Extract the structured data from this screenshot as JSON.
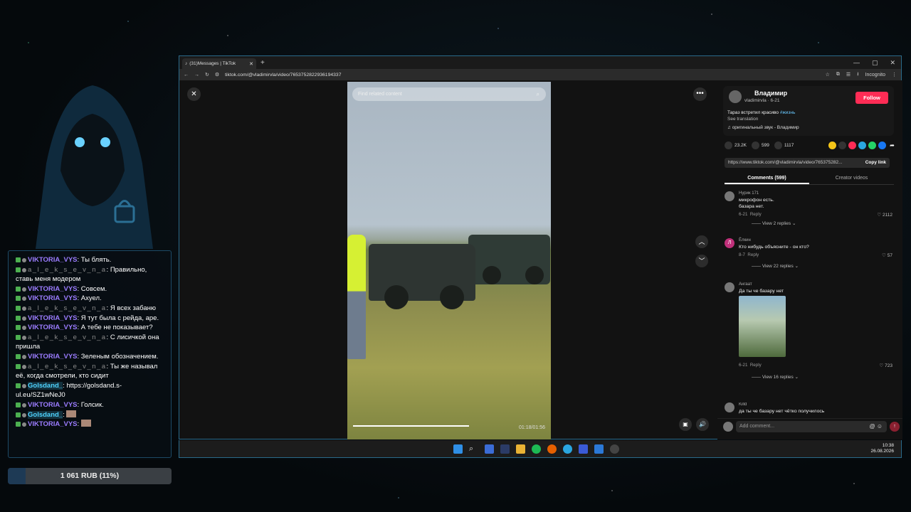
{
  "chat": {
    "messages": [
      {
        "user": "VIKTORIA_VYS",
        "kind": "v",
        "text": "Ты блять."
      },
      {
        "user": "a_l_e_k_s_e_v_n_a",
        "kind": "a",
        "text": "Правильно, ставь меня модером"
      },
      {
        "user": "VIKTORIA_VYS",
        "kind": "v",
        "text": "Совсем."
      },
      {
        "user": "VIKTORIA_VYS",
        "kind": "v",
        "text": "Ахуел."
      },
      {
        "user": "a_l_e_k_s_e_v_n_a",
        "kind": "a",
        "text": "Я всех забаню"
      },
      {
        "user": "VIKTORIA_VYS",
        "kind": "v",
        "text": "Я тут была с рейда, аре."
      },
      {
        "user": "VIKTORIA_VYS",
        "kind": "v",
        "text": "А тебе не показывает?"
      },
      {
        "user": "a_l_e_k_s_e_v_n_a",
        "kind": "a",
        "text": "С лисичкой она пришла"
      },
      {
        "user": "VIKTORIA_VYS",
        "kind": "v",
        "text": "Зеленым обозначением."
      },
      {
        "user": "a_l_e_k_s_e_v_n_a",
        "kind": "a",
        "text": "Ты же называл её, когда смотрели, кто сидит"
      },
      {
        "user": "Golsdand_",
        "kind": "g",
        "text": "https://golsdand.s-ul.eu/SZ1wNeJ0"
      },
      {
        "user": "VIKTORIA_VYS",
        "kind": "v",
        "text": "Голсик."
      },
      {
        "user": "Golsdand_",
        "kind": "g",
        "text": ""
      },
      {
        "user": "VIKTORIA_VYS",
        "kind": "v",
        "text": ""
      }
    ]
  },
  "donation": {
    "label": "1 061 RUB (11%)",
    "progress": 0.11
  },
  "browser": {
    "tab_title": "(31)Messages | TikTok",
    "url": "tiktok.com/@vladimirvla/video/7653752822936194337",
    "incognito": "Incognito"
  },
  "video": {
    "search_placeholder": "Find related content",
    "time": "01:18/01:56",
    "progress": 0.6
  },
  "author": {
    "name": "Владимир",
    "handle": "vladimirvla · 6-21",
    "follow": "Follow",
    "desc": "Тараз встретил красиво",
    "hashtag": "#жизнь",
    "translation": "See translation",
    "music": "оригинальный звук - Владимир"
  },
  "stats": {
    "likes": "23.2K",
    "comments": "599",
    "saves": "1117"
  },
  "link": {
    "url": "https://www.tiktok.com/@vladimirvla/video/765375282...",
    "copy": "Copy link"
  },
  "tabs": {
    "comments": "Comments (599)",
    "creator": "Creator videos"
  },
  "comments": [
    {
      "name": "Нурик 171",
      "text": "микрофон есть.\nбазара нет.",
      "date": "6-21",
      "reply": "Reply",
      "likes": "2112",
      "replies": "View 2 replies"
    },
    {
      "name": "Ёлкин",
      "text": "Кто нибудь объясните - он кто?",
      "date": "8-7",
      "reply": "Reply",
      "likes": "57",
      "replies": "View 22 replies"
    },
    {
      "name": "Ангаат",
      "text": "Да ты че базару нет",
      "date": "6-21",
      "reply": "Reply",
      "likes": "723",
      "replies": "View 16 replies"
    },
    {
      "name": "Killd",
      "text": "да ты че базару нет чётко получилось"
    }
  ],
  "add_comment": {
    "placeholder": "Add comment..."
  },
  "taskbar": {
    "time": "10:38",
    "date": "26.08.2026"
  }
}
